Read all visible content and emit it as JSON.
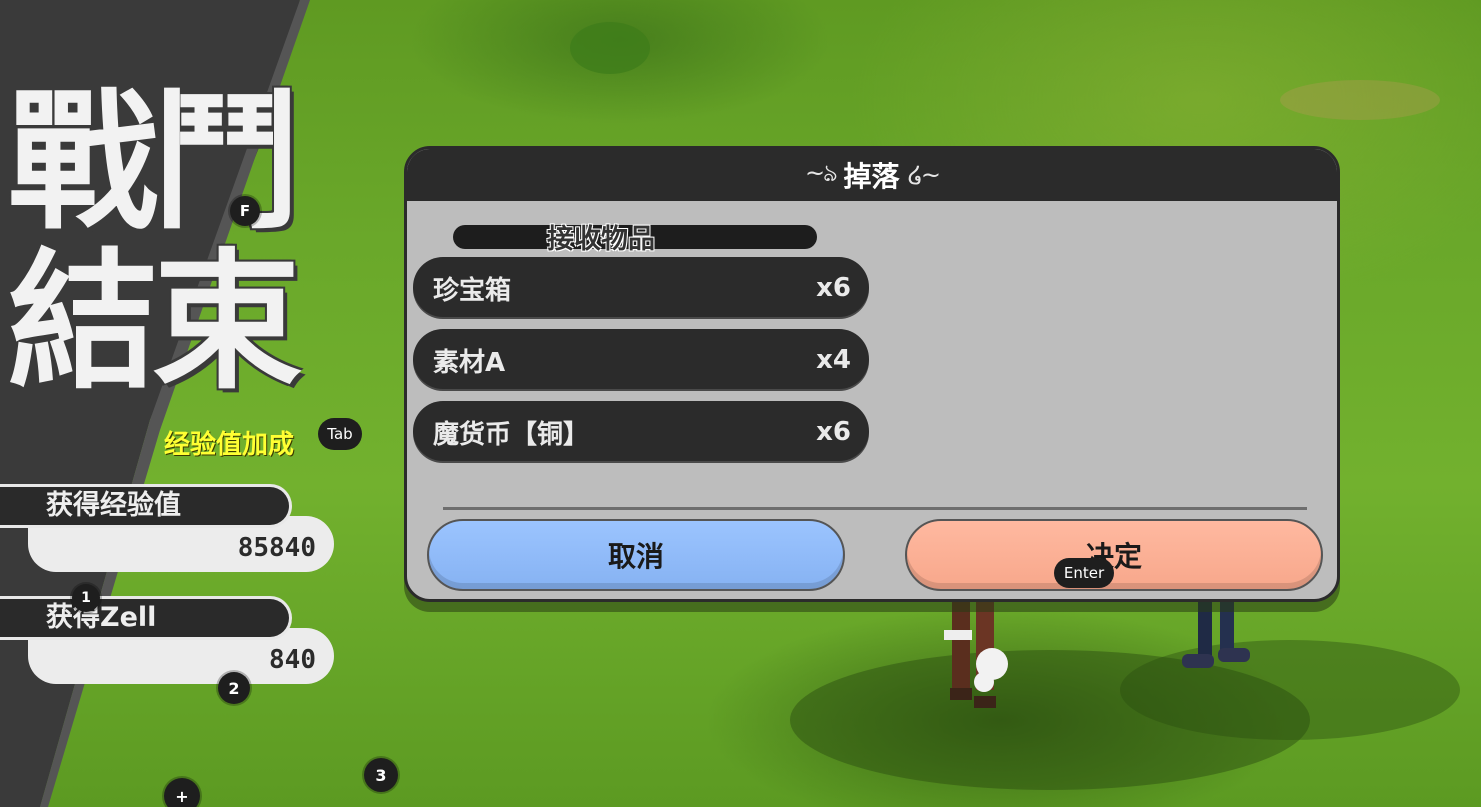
{
  "battle_end": {
    "title_line1": "戰鬥",
    "title_line2": "結束",
    "key_f": "F",
    "bonus_label": "经验值加成",
    "key_tab": "Tab",
    "exp_label": "获得经验值",
    "exp_value": "85840",
    "zell_label": "获得Zell",
    "zell_value": "840",
    "hotkeys": {
      "k1": "1",
      "k2": "2",
      "k3": "3",
      "plus": "+"
    }
  },
  "dialog": {
    "title": "掉落",
    "section_label": "接收物品",
    "items": [
      {
        "name": "珍宝箱",
        "qty": "x6"
      },
      {
        "name": "素材A",
        "qty": "x4"
      },
      {
        "name": "魔货币【铜】",
        "qty": "x6"
      }
    ],
    "cancel_label": "取消",
    "confirm_label": "决定",
    "confirm_key": "Enter"
  },
  "colors": {
    "panel_dark": "#2b2b2b",
    "panel_light": "#bdbdbd",
    "cancel_button": "#8fb9f8",
    "confirm_button": "#fbae93",
    "bonus_text": "#ffff33",
    "grass": "#6aa82a"
  }
}
